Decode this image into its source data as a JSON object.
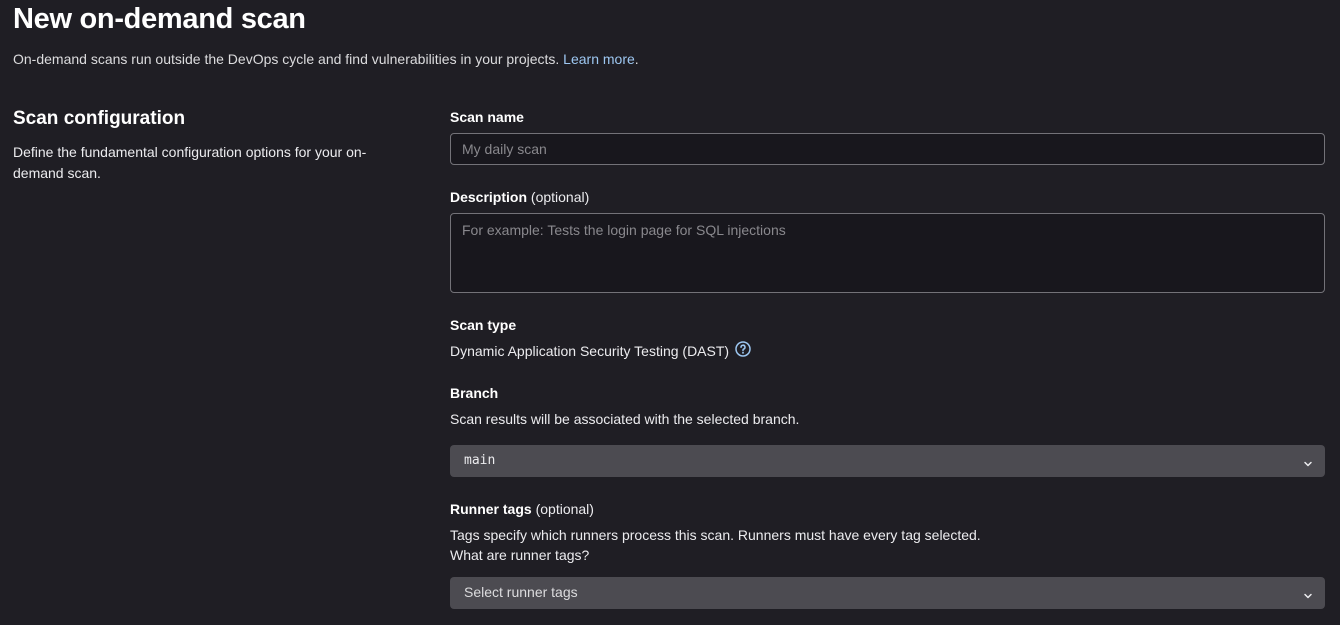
{
  "header": {
    "title": "New on-demand scan",
    "description": "On-demand scans run outside the DevOps cycle and find vulnerabilities in your projects.",
    "learn_more": "Learn more",
    "period": "."
  },
  "section": {
    "title": "Scan configuration",
    "description": "Define the fundamental configuration options for your on-demand scan."
  },
  "form": {
    "scan_name": {
      "label": "Scan name",
      "value": "",
      "placeholder": "My daily scan"
    },
    "description": {
      "label": "Description",
      "optional": "(optional)",
      "value": "",
      "placeholder": "For example: Tests the login page for SQL injections"
    },
    "scan_type": {
      "label": "Scan type",
      "value": "Dynamic Application Security Testing (DAST)",
      "icon": "question-circle-icon"
    },
    "branch": {
      "label": "Branch",
      "help": "Scan results will be associated with the selected branch.",
      "selected": "main",
      "icon": "chevron-down-icon"
    },
    "runner_tags": {
      "label": "Runner tags",
      "optional": "(optional)",
      "help": "Tags specify which runners process this scan. Runners must have every tag selected.",
      "link": "What are runner tags?",
      "placeholder": "Select runner tags",
      "icon": "chevron-down-icon"
    }
  },
  "colors": {
    "background": "#1f1e24",
    "link": "#9dc7f1",
    "input_bg": "#18171d",
    "input_border": "#737278",
    "dropdown_bg": "#4c4b51"
  }
}
